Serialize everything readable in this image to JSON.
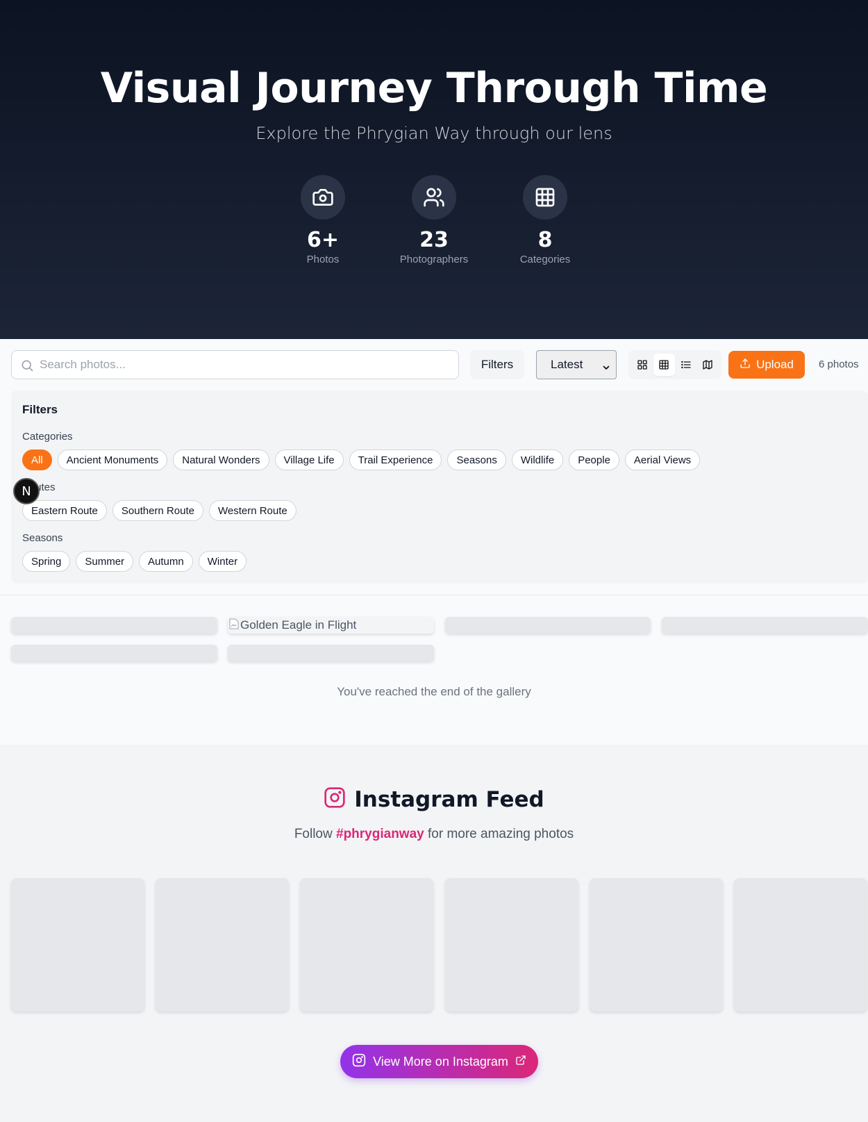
{
  "hero": {
    "title": "Visual Journey Through Time",
    "subtitle": "Explore the Phrygian Way through our lens",
    "stats": [
      {
        "icon": "camera-icon",
        "value": "6+",
        "label": "Photos"
      },
      {
        "icon": "users-icon",
        "value": "23",
        "label": "Photographers"
      },
      {
        "icon": "grid-icon",
        "value": "8",
        "label": "Categories"
      }
    ]
  },
  "toolbar": {
    "search_placeholder": "Search photos...",
    "filters_label": "Filters",
    "sort_value": "Latest",
    "view_modes": [
      "masonry-view-icon",
      "grid-view-icon",
      "list-view-icon",
      "map-view-icon"
    ],
    "active_view": "grid-view-icon",
    "upload_label": "Upload",
    "photo_count": "6 photos"
  },
  "filters": {
    "title": "Filters",
    "categories_label": "Categories",
    "categories": [
      "All",
      "Ancient Monuments",
      "Natural Wonders",
      "Village Life",
      "Trail Experience",
      "Seasons",
      "Wildlife",
      "People",
      "Aerial Views"
    ],
    "active_category": "All",
    "routes_label": "Routes",
    "routes": [
      "Eastern Route",
      "Southern Route",
      "Western Route"
    ],
    "seasons_label": "Seasons",
    "seasons": [
      "Spring",
      "Summer",
      "Autumn",
      "Winter"
    ]
  },
  "overlay_badge": "N",
  "gallery": {
    "broken_image_alt": "Golden Eagle in Flight",
    "end_text": "You've reached the end of the gallery"
  },
  "instagram": {
    "title": "Instagram Feed",
    "subtitle_prefix": "Follow",
    "hashtag": "#phrygianway",
    "subtitle_suffix": "for more amazing photos",
    "button_label": "View More on Instagram",
    "colors": {
      "accent": "#db2777",
      "gradient_start": "#9333ea",
      "gradient_end": "#db2777"
    }
  },
  "colors": {
    "brand_orange": "#f97316",
    "hero_bg": "#111827"
  }
}
